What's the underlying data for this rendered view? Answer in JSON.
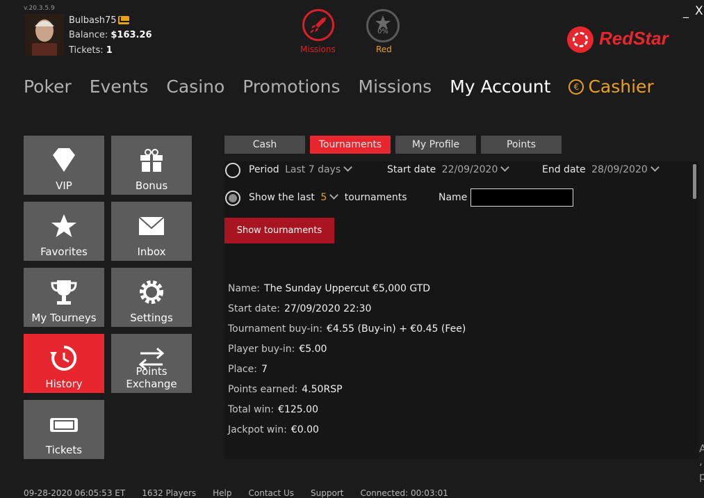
{
  "app": {
    "version": "v.20.3.5.9",
    "brand": "RedStar"
  },
  "user": {
    "name": "Bulbash75",
    "balance_label": "Balance:",
    "balance": "$163.26",
    "tickets_label": "Tickets:",
    "tickets": "1"
  },
  "header": {
    "missions_label": "Missions",
    "red_label": "Red",
    "red_percent": "0%",
    "minimize": "_",
    "close": "X"
  },
  "nav": {
    "items": [
      "Poker",
      "Events",
      "Casino",
      "Promotions",
      "Missions",
      "My Account"
    ],
    "active": "My Account",
    "cashier": "Cashier",
    "cashier_symbol": "€"
  },
  "tiles": [
    {
      "label": "VIP"
    },
    {
      "label": "Bonus"
    },
    {
      "label": "Favorites"
    },
    {
      "label": "Inbox"
    },
    {
      "label": "My Tourneys"
    },
    {
      "label": "Settings"
    },
    {
      "label": "History"
    },
    {
      "label": "Points Exchange"
    },
    {
      "label": "Tickets"
    }
  ],
  "tabs": [
    "Cash",
    "Tournaments",
    "My Profile",
    "Points"
  ],
  "filters": {
    "period_label": "Period",
    "period_value": "Last 7 days",
    "start_label": "Start date",
    "start_value": "22/09/2020",
    "end_label": "End date",
    "end_value": "28/09/2020",
    "show_last_label": "Show the last",
    "show_last_value": "5",
    "show_last_suffix": "tournaments",
    "name_label": "Name",
    "name_value": "",
    "button": "Show tournaments"
  },
  "details": [
    {
      "label": "Name:",
      "value": "The Sunday Uppercut €5,000 GTD"
    },
    {
      "label": "Start date:",
      "value": "27/09/2020 22:30"
    },
    {
      "label": "Tournament buy-in:",
      "value": "€4.55 (Buy-in) + €0.45 (Fee)"
    },
    {
      "label": "Player buy-in:",
      "value": "€5.00"
    },
    {
      "label": "Place:",
      "value": "7"
    },
    {
      "label": "Points earned:",
      "value": "4.50RSP"
    },
    {
      "label": "Total win:",
      "value": "€125.00"
    },
    {
      "label": "Jackpot win:",
      "value": "€0.00"
    }
  ],
  "footer": {
    "datetime": "09-28-2020 06:05:53 ET",
    "players": "1632 Players",
    "help": "Help",
    "contact": "Contact Us",
    "support": "Support",
    "connected": "Connected: 00:03:01"
  },
  "edge": {
    "a": "A",
    "comma": ",",
    "p": "p"
  },
  "colors": {
    "accent": "#e8262e",
    "gold": "#e8a21a",
    "tile": "#5c5c5c",
    "button": "#a81420"
  }
}
